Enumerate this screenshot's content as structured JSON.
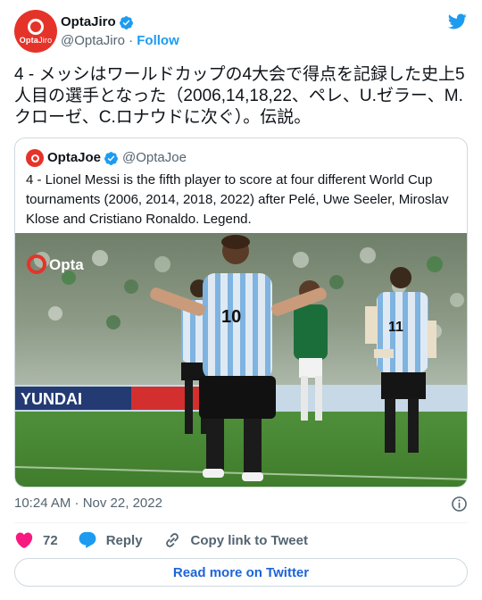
{
  "colors": {
    "brand_red": "#e5332a",
    "twitter_blue": "#1d9bf0",
    "text": "#0f1419",
    "muted": "#536471",
    "heart": "#f91880",
    "border": "#cfd9de"
  },
  "author": {
    "name": "OptaJiro",
    "handle": "@OptaJiro",
    "separator": "·",
    "follow_label": "Follow",
    "avatar_text": "Opta",
    "avatar_text_suffix": "Jiro",
    "verified_icon": "verified-badge-icon"
  },
  "tweet": {
    "text": "4 - メッシはワールドカップの4大会で得点を記録した史上5人目の選手となった（2006,14,18,22、ペレ、U.ゼラー、M.クローゼ、C.ロナウドに次ぐ）。伝説。"
  },
  "quote": {
    "name": "OptaJoe",
    "handle": "@OptaJoe",
    "text": "4 - Lionel Messi is the fifth player to score at four different World Cup tournaments (2006, 2014, 2018, 2022) after Pelé, Uwe Seeler, Miroslav Klose and Cristiano Ronaldo. Legend.",
    "photo": {
      "watermark": "Opta",
      "board_text": "YUNDAI",
      "jersey_number": "10",
      "jersey_number_right": "11"
    }
  },
  "footer": {
    "timestamp": "10:24 AM · Nov 22, 2022",
    "likes": "72",
    "reply_label": "Reply",
    "copy_label": "Copy link to Tweet",
    "read_more_label": "Read more on Twitter"
  }
}
